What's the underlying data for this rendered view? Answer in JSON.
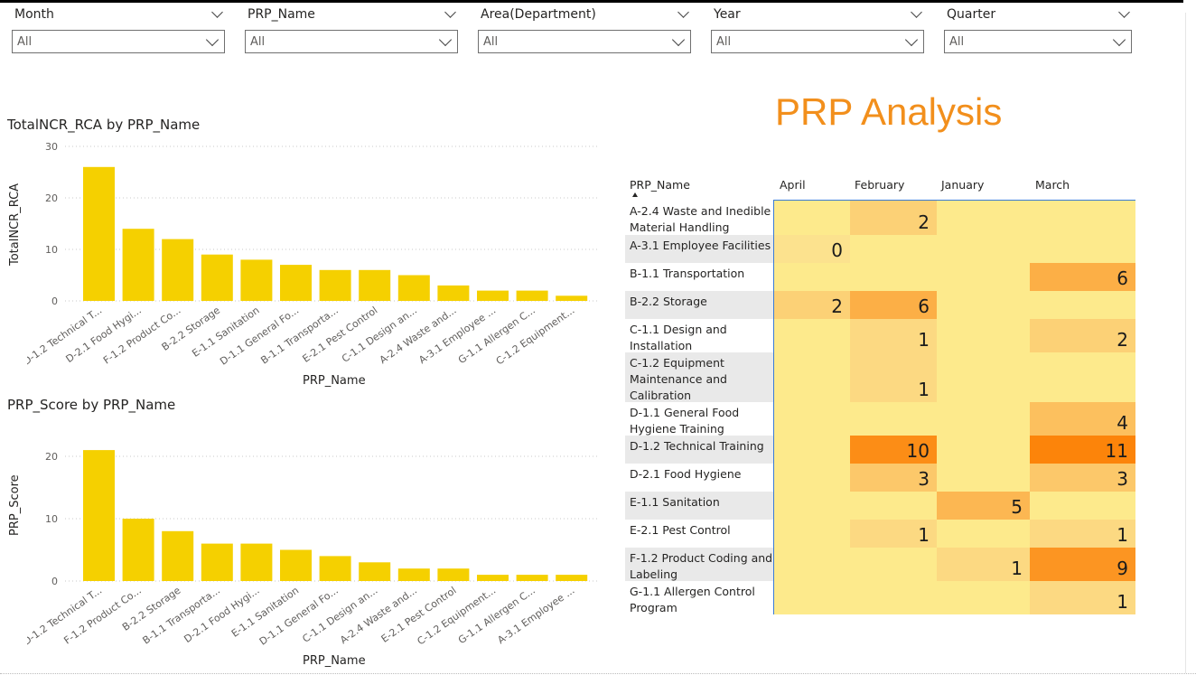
{
  "slicers": [
    {
      "title": "Month",
      "value": "All"
    },
    {
      "title": "PRP_Name",
      "value": "All"
    },
    {
      "title": "Area(Department)",
      "value": "All"
    },
    {
      "title": "Year",
      "value": "All"
    },
    {
      "title": "Quarter",
      "value": "All"
    }
  ],
  "report_title": "PRP Analysis",
  "chart_data": [
    {
      "type": "bar",
      "title": "TotalNCR_RCA by PRP_Name",
      "xlabel": "PRP_Name",
      "ylabel": "TotalNCR_RCA",
      "ylim": [
        0,
        30
      ],
      "yticks": [
        0,
        10,
        20,
        30
      ],
      "grid": true,
      "color": "#f5d000",
      "categories": [
        "D-1.2 Technical T...",
        "D-2.1 Food Hygi...",
        "F-1.2 Product Co...",
        "B-2.2 Storage",
        "E-1.1 Sanitation",
        "D-1.1 General Fo...",
        "B-1.1 Transporta...",
        "E-2.1 Pest Control",
        "C-1.1 Design an...",
        "A-2.4 Waste and...",
        "A-3.1 Employee ...",
        "G-1.1 Allergen C...",
        "C-1.2 Equipment..."
      ],
      "values": [
        26,
        14,
        12,
        9,
        8,
        7,
        6,
        6,
        5,
        3,
        2,
        2,
        1
      ]
    },
    {
      "type": "bar",
      "title": "PRP_Score by PRP_Name",
      "xlabel": "PRP_Name",
      "ylabel": "PRP_Score",
      "ylim": [
        0,
        23
      ],
      "yticks": [
        0,
        10,
        20
      ],
      "grid": true,
      "color": "#f5d000",
      "categories": [
        "D-1.2 Technical T...",
        "F-1.2 Product Co...",
        "B-2.2 Storage",
        "B-1.1 Transporta...",
        "D-2.1 Food Hygi...",
        "E-1.1 Sanitation",
        "D-1.1 General Fo...",
        "C-1.1 Design an...",
        "A-2.4 Waste and...",
        "E-2.1 Pest Control",
        "C-1.2 Equipment...",
        "G-1.1 Allergen C...",
        "A-3.1 Employee ..."
      ],
      "values": [
        21,
        10,
        8,
        6,
        6,
        5,
        4,
        3,
        2,
        2,
        1,
        1,
        1
      ]
    },
    {
      "type": "table",
      "row_header": "PRP_Name",
      "columns": [
        "April",
        "February",
        "January",
        "March"
      ],
      "rows": [
        {
          "name": "A-2.4 Waste and Inedible Material Handling",
          "values": [
            null,
            2,
            null,
            null
          ]
        },
        {
          "name": "A-3.1 Employee Facilities",
          "values": [
            0,
            null,
            null,
            null
          ]
        },
        {
          "name": "B-1.1 Transportation",
          "values": [
            null,
            null,
            null,
            6
          ]
        },
        {
          "name": "B-2.2 Storage",
          "values": [
            2,
            6,
            null,
            null
          ]
        },
        {
          "name": "C-1.1 Design and Installation",
          "values": [
            null,
            1,
            null,
            2
          ]
        },
        {
          "name": "C-1.2 Equipment Maintenance and Calibration",
          "values": [
            null,
            1,
            null,
            null
          ]
        },
        {
          "name": "D-1.1 General Food Hygiene Training",
          "values": [
            null,
            null,
            null,
            4
          ]
        },
        {
          "name": "D-1.2 Technical Training",
          "values": [
            null,
            10,
            null,
            11
          ]
        },
        {
          "name": "D-2.1 Food Hygiene",
          "values": [
            null,
            3,
            null,
            3
          ]
        },
        {
          "name": "E-1.1 Sanitation",
          "values": [
            null,
            null,
            5,
            null
          ]
        },
        {
          "name": "E-2.1 Pest Control",
          "values": [
            null,
            1,
            null,
            1
          ]
        },
        {
          "name": "F-1.2 Product Coding and Labeling",
          "values": [
            null,
            null,
            1,
            9
          ]
        },
        {
          "name": "G-1.1 Allergen Control Program",
          "values": [
            null,
            null,
            null,
            1
          ]
        }
      ]
    }
  ]
}
